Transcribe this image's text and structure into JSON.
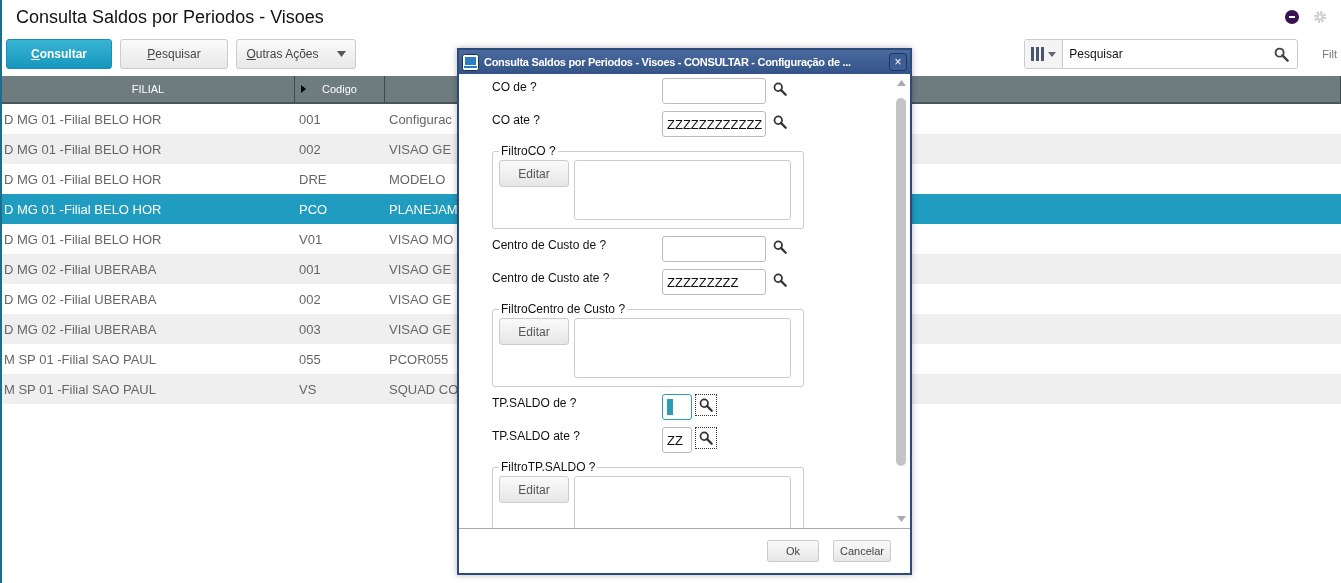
{
  "page": {
    "title": "Consulta Saldos por Periodos - Visoes"
  },
  "toolbar": {
    "buttons": [
      {
        "label": "Consultar",
        "kind": "primary",
        "accelerator": true
      },
      {
        "label": "Pesquisar",
        "kind": "secondary",
        "accelerator": true
      },
      {
        "label": "Outras Ações",
        "kind": "dropdown",
        "accelerator": true
      }
    ],
    "search": {
      "placeholder": "Pesquisar"
    },
    "filter_link": "Filt"
  },
  "table": {
    "columns": [
      "FILIAL",
      "Codigo"
    ],
    "rows": [
      {
        "cells": [
          "D MG 01 -Filial BELO HOR",
          "001",
          "Configurac"
        ],
        "selected": false
      },
      {
        "cells": [
          "D MG 01 -Filial BELO HOR",
          "002",
          "VISAO GE"
        ],
        "selected": false
      },
      {
        "cells": [
          "D MG 01 -Filial BELO HOR",
          "DRE",
          "MODELO"
        ],
        "selected": false
      },
      {
        "cells": [
          "D MG 01 -Filial BELO HOR",
          "PCO",
          "PLANEJAM"
        ],
        "selected": true
      },
      {
        "cells": [
          "D MG 01 -Filial BELO HOR",
          "V01",
          "VISAO MO"
        ],
        "selected": false
      },
      {
        "cells": [
          "D MG 02 -Filial UBERABA",
          "001",
          "VISAO GE"
        ],
        "selected": false
      },
      {
        "cells": [
          "D MG 02 -Filial UBERABA",
          "002",
          "VISAO GE"
        ],
        "selected": false
      },
      {
        "cells": [
          "D MG 02 -Filial UBERABA",
          "003",
          "VISAO GE"
        ],
        "selected": false
      },
      {
        "cells": [
          "M SP 01 -Filial SAO PAUL",
          "055",
          "PCOR055"
        ],
        "selected": false
      },
      {
        "cells": [
          "M SP 01 -Filial SAO PAUL",
          "VS",
          "SQUAD CO"
        ],
        "selected": false
      }
    ]
  },
  "dialog": {
    "title": "Consulta Saldos por Periodos - Visoes - CONSULTAR - Configuração de ...",
    "close": "×",
    "fields": [
      {
        "kind": "lookup",
        "label": "CO de  ?",
        "focused": false
      },
      {
        "kind": "lookup",
        "label": "CO ate  ?",
        "value": "ZZZZZZZZZZZZ",
        "focused": false
      },
      {
        "kind": "filter",
        "label": "FiltroCO ?",
        "button": "Editar"
      },
      {
        "kind": "lookup",
        "label": "Centro de Custo de  ?",
        "focused": false
      },
      {
        "kind": "lookup",
        "label": "Centro de Custo ate  ?",
        "value": "ZZZZZZZZZ",
        "focused": false
      },
      {
        "kind": "filter",
        "label": "FiltroCentro de Custo ?",
        "button": "Editar"
      },
      {
        "kind": "code_lookup",
        "label": "TP.SALDO de  ?",
        "focused": true
      },
      {
        "kind": "code_lookup",
        "label": "TP.SALDO ate  ?",
        "value": "ZZ",
        "focused": false
      },
      {
        "kind": "filter",
        "label": "FiltroTP.SALDO ?",
        "button": "Editar"
      }
    ],
    "buttons": [
      "Ok",
      "Cancelar"
    ]
  }
}
